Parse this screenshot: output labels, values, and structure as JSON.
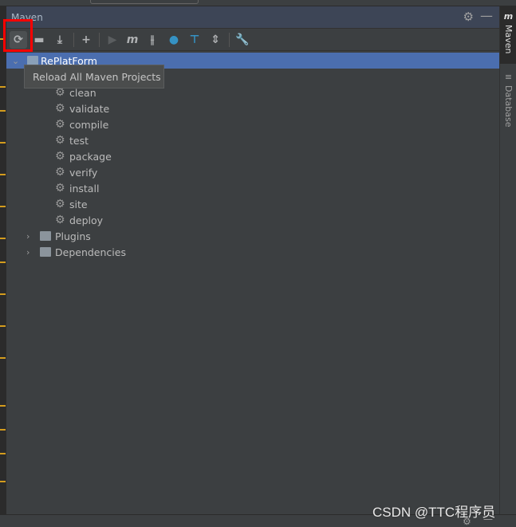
{
  "panel": {
    "title": "Maven"
  },
  "toolbar": {
    "buttons": [
      "reload-all-icon",
      "add-folder-icon",
      "download-icon",
      "add-icon",
      "run-icon",
      "maven-goal-icon",
      "toggle-offline-icon",
      "skip-tests-icon",
      "show-dependencies-icon",
      "collapse-all-icon",
      "settings-wrench-icon"
    ]
  },
  "tree": {
    "project": "RePlatForm",
    "lifecycle": [
      "clean",
      "validate",
      "compile",
      "test",
      "package",
      "verify",
      "install",
      "site",
      "deploy"
    ],
    "plugins": "Plugins",
    "dependencies": "Dependencies"
  },
  "tooltip": "Reload All Maven Projects",
  "right_tabs": {
    "maven": "Maven",
    "database": "Database",
    "maven_glyph": "m"
  },
  "watermark": "CSDN @TTC程序员",
  "colors": {
    "selection": "#4b6eaf",
    "highlight_box": "#ff0000",
    "background": "#3c3f41"
  }
}
